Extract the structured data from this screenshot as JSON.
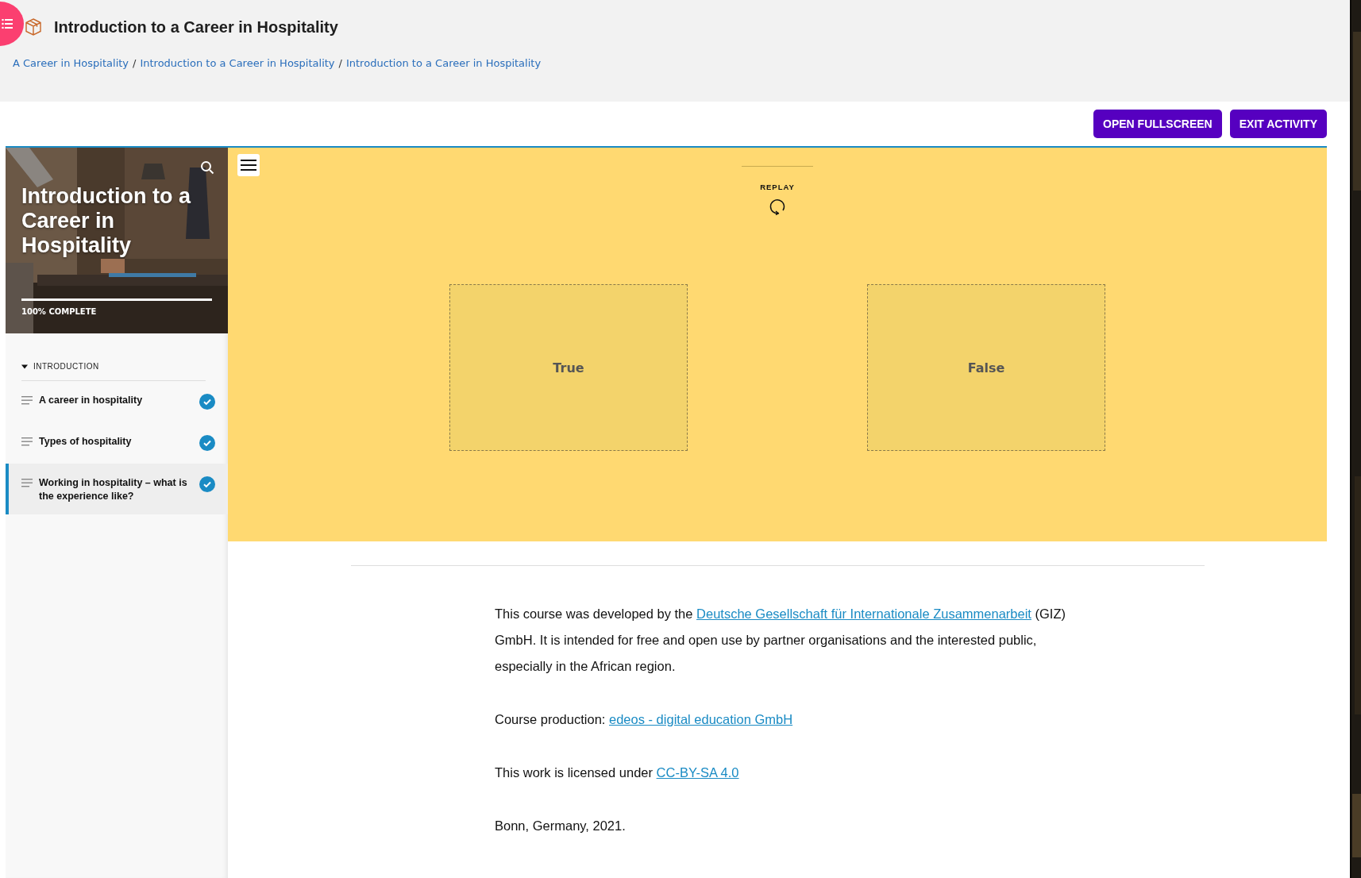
{
  "header": {
    "title": "Introduction to a Career in Hospitality",
    "separator": "/",
    "breadcrumbs": [
      "A Career in Hospitality",
      "Introduction to a Career in Hospitality",
      "Introduction to a Career in Hospitality"
    ]
  },
  "toolbar": {
    "buttons": [
      "OPEN FULLSCREEN",
      "EXIT ACTIVITY"
    ]
  },
  "sidebar": {
    "title": "Introduction to a Career in Hospitality",
    "progress": {
      "level": 1,
      "label": "100% COMPLETE"
    },
    "section": {
      "label": "INTRODUCTION",
      "expanded": true,
      "items": [
        {
          "label": "A career in hospitality",
          "completed": true,
          "selected": false
        },
        {
          "label": "Types of hospitality",
          "completed": true,
          "selected": false
        },
        {
          "label": "Working in hospitality – what is the experience like?",
          "completed": true,
          "selected": true
        }
      ]
    }
  },
  "activity": {
    "replay": "REPLAY",
    "drop_zones": [
      "True",
      "False"
    ]
  },
  "footer": {
    "paragraphs": [
      [
        {
          "text": "This course was developed by the "
        },
        {
          "link": "Deutsche Gesellschaft für Internationale Zusammenarbeit"
        },
        {
          "text": " (GIZ) GmbH. It is intended for free and open use by partner organisations and the interested public, especially in the African region."
        }
      ],
      [
        {
          "text": "Course production: "
        },
        {
          "link": "edeos - digital education GmbH"
        }
      ],
      [
        {
          "text": "This work is licensed under "
        },
        {
          "link": "CC-BY-SA 4.0"
        }
      ],
      [
        {
          "text": "Bonn, Germany, 2021."
        }
      ]
    ]
  }
}
